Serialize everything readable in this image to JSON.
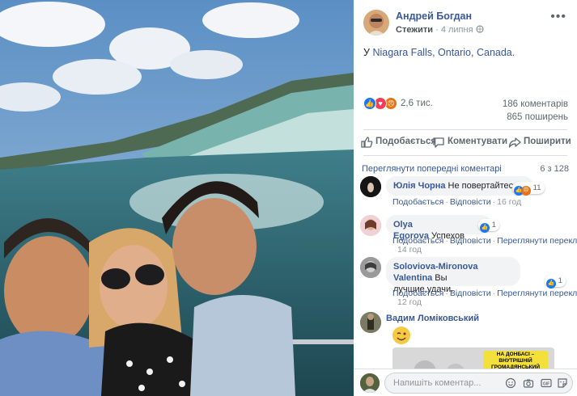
{
  "post": {
    "author": "Андрей Богдан",
    "follow": "Стежити",
    "date": "4 липня",
    "text_prefix": "У",
    "place": "Niagara Falls, Ontario, Canada."
  },
  "reactions": {
    "total": "2,6 тис.",
    "comments": "186 коментарів",
    "shares": "865 поширень"
  },
  "actions": {
    "like": "Подобається",
    "comment": "Коментувати",
    "share": "Поширити"
  },
  "comments_header": {
    "view_previous": "Переглянути попередні коментарі",
    "count": "6 з 128"
  },
  "comments": [
    {
      "name": "Юлія Чорна",
      "text": "Не повертайтесь.",
      "like": "Подобається",
      "reply": "Відповісти",
      "time": "16 год",
      "reactions_count": "11"
    },
    {
      "name": "Olya Egorova",
      "text": "Успехов",
      "like": "Подобається",
      "reply": "Відповісти",
      "translate": "Переглянути переклад",
      "time": "14 год",
      "reactions_count": "1"
    },
    {
      "name": "Soloviova-Mironova Valentina",
      "text_line1": "Вы",
      "text_line2": "лучшие,удачи.",
      "like": "Подобається",
      "reply": "Відповісти",
      "translate": "Переглянути переклад",
      "time": "12 год",
      "reactions_count": "1"
    },
    {
      "name": "Вадим Ломіковський",
      "meme_caption": "НА ДОНБАСІ – ВНУТРІШНІЙ ГРОМАДЯНСЬКИЙ КОНФЛІКТ"
    }
  ],
  "composer": {
    "placeholder": "Напишіть коментар..."
  },
  "colors": {
    "link": "#385898",
    "secondary": "#606770",
    "like_blue": "#1877f2",
    "love_red": "#f33e58",
    "angry_orange": "#e9710f"
  },
  "icons": [
    "more-icon",
    "like-icon",
    "comment-icon",
    "share-icon",
    "emoji-icon",
    "camera-icon",
    "gif-icon",
    "sticker-icon"
  ]
}
